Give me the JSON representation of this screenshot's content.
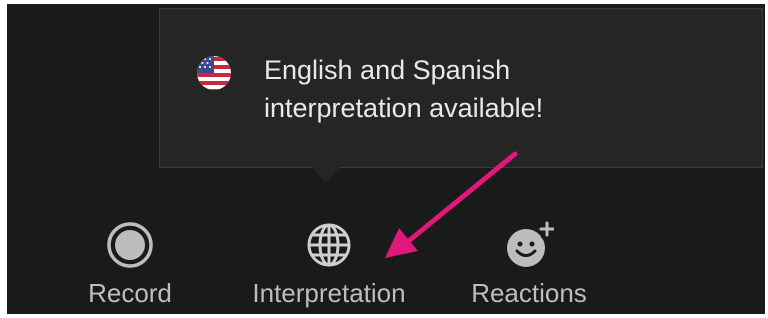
{
  "tooltip": {
    "line1": "English and Spanish",
    "line2": "interpretation available!",
    "flag_icon": "us-flag-icon"
  },
  "toolbar": {
    "items": [
      {
        "label": "Record",
        "icon": "record-icon"
      },
      {
        "label": "Interpretation",
        "icon": "globe-icon"
      },
      {
        "label": "Reactions",
        "icon": "add-reaction-icon"
      }
    ]
  },
  "colors": {
    "background": "#1a1a1a",
    "tooltip_bg": "#252525",
    "text": "#e8e8e8",
    "label": "#bdbdbd",
    "annotation_arrow": "#e0187a"
  }
}
